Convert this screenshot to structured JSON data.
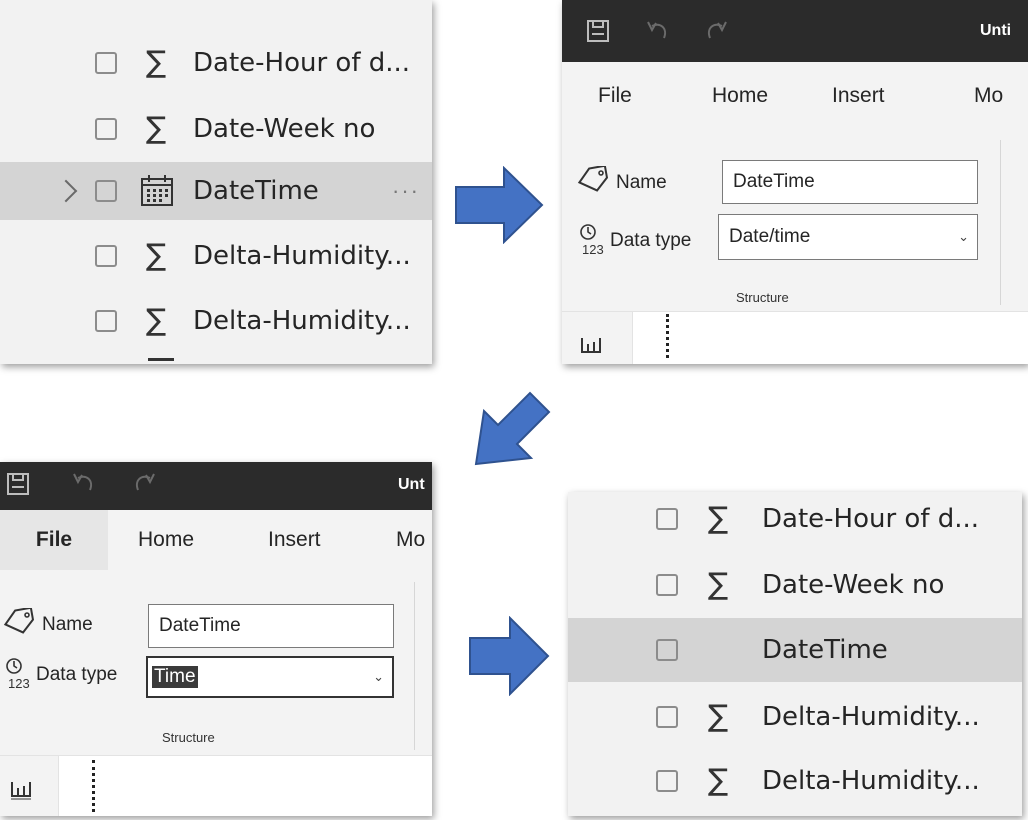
{
  "colors": {
    "arrow_fill": "#4472c4",
    "arrow_stroke": "#2f528f",
    "selected_row": "#d4d4d4",
    "titlebar": "#2b2b2b"
  },
  "panel_before_fields": {
    "fields": [
      {
        "label": "Date-Hour of d...",
        "icon": "sigma-icon"
      },
      {
        "label": "Date-Week no",
        "icon": "sigma-icon"
      },
      {
        "label": "DateTime",
        "icon": "calendar-icon",
        "selected": true,
        "expandable": true,
        "more": "···"
      },
      {
        "label": "Delta-Humidity...",
        "icon": "sigma-icon"
      },
      {
        "label": "Delta-Humidity...",
        "icon": "sigma-icon"
      }
    ]
  },
  "panel_ribbon_before": {
    "app_title": "Unti",
    "tabs": [
      "File",
      "Home",
      "Insert",
      "Mo"
    ],
    "name_label": "Name",
    "name_value": "DateTime",
    "datatype_label": "Data type",
    "datatype_value": "Date/time",
    "group_label": "Structure"
  },
  "panel_ribbon_after": {
    "app_title": "Unt",
    "tabs": [
      "File",
      "Home",
      "Insert",
      "Mo"
    ],
    "name_label": "Name",
    "name_value": "DateTime",
    "datatype_label": "Data type",
    "datatype_value": "Time",
    "group_label": "Structure"
  },
  "panel_after_fields": {
    "fields": [
      {
        "label": "Date-Hour of d...",
        "icon": "sigma-icon"
      },
      {
        "label": "Date-Week no",
        "icon": "sigma-icon"
      },
      {
        "label": "DateTime",
        "icon": "none",
        "selected": true
      },
      {
        "label": "Delta-Humidity...",
        "icon": "sigma-icon"
      },
      {
        "label": "Delta-Humidity...",
        "icon": "sigma-icon"
      }
    ]
  },
  "glyphs": {
    "sigma": "∑",
    "chevron_down": "⌄"
  }
}
